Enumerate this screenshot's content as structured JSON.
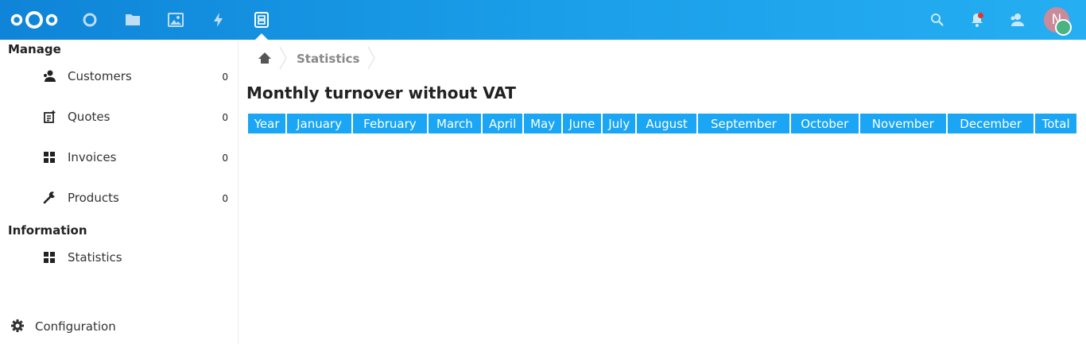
{
  "header": {
    "apps": [
      {
        "name": "dashboard",
        "icon": "circle-icon"
      },
      {
        "name": "files",
        "icon": "folder-icon"
      },
      {
        "name": "photos",
        "icon": "image-icon"
      },
      {
        "name": "activity",
        "icon": "lightning-icon"
      },
      {
        "name": "accounting",
        "icon": "ledger-icon",
        "active": true
      }
    ],
    "avatar_initial": "N",
    "status_color": "#49b382",
    "accent": "#1aa6f4"
  },
  "sidebar": {
    "manage_title": "Manage",
    "manage_items": [
      {
        "label": "Customers",
        "count": "0",
        "icon": "customers-icon"
      },
      {
        "label": "Quotes",
        "count": "0",
        "icon": "quote-icon"
      },
      {
        "label": "Invoices",
        "count": "0",
        "icon": "grid-icon"
      },
      {
        "label": "Products",
        "count": "0",
        "icon": "wrench-icon"
      }
    ],
    "information_title": "Information",
    "information_items": [
      {
        "label": "Statistics",
        "icon": "grid-icon"
      }
    ],
    "configuration_label": "Configuration"
  },
  "main": {
    "breadcrumb": "Statistics",
    "title": "Monthly turnover without VAT",
    "columns": [
      "Year",
      "January",
      "February",
      "March",
      "April",
      "May",
      "June",
      "July",
      "August",
      "September",
      "October",
      "November",
      "December",
      "Total"
    ]
  }
}
